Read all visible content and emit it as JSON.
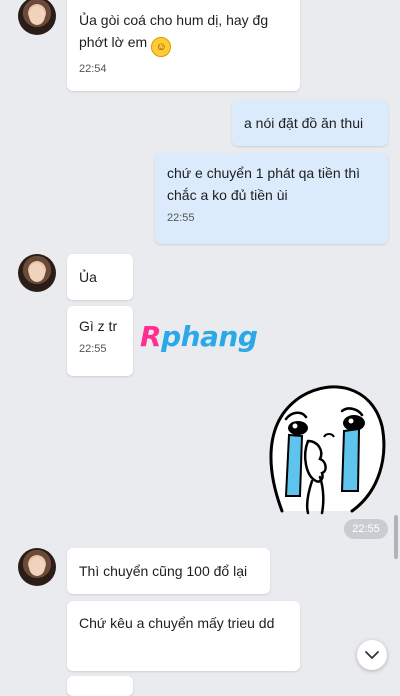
{
  "messages": [
    {
      "sender": "them",
      "text": "Ủa gòi coá cho hum dị, hay đg phớt lờ em",
      "emoji": "grinning-face-with-tears",
      "time": "22:54"
    },
    {
      "sender": "me",
      "text": "a nói đặt đồ ăn thui"
    },
    {
      "sender": "me",
      "text": "chứ e chuyển 1 phát qa tiền thì chắc a ko đủ tiền ùi",
      "time": "22:55"
    },
    {
      "sender": "them",
      "text": "Ủa"
    },
    {
      "sender": "them",
      "text": "Gì z tr",
      "time": "22:55"
    },
    {
      "sender": "me",
      "sticker": "crying-blob-sticker",
      "time": "22:55"
    },
    {
      "sender": "them",
      "text": "Thì chuyển cũng 100 đổ lại"
    },
    {
      "sender": "them",
      "text": "Chứ kêu a chuyển mấy trieu dd"
    }
  ],
  "watermark": {
    "first": "R",
    "rest": "phang"
  },
  "colors": {
    "background": "#e9ebee",
    "incoming_bubble": "#ffffff",
    "outgoing_bubble": "#dcebfb",
    "watermark_r": "#ff2f92",
    "watermark_rest": "#2aa8e8"
  },
  "icons": {
    "scroll_down": "chevron-down-icon",
    "emoji": "grinning-face-with-tears-icon"
  }
}
